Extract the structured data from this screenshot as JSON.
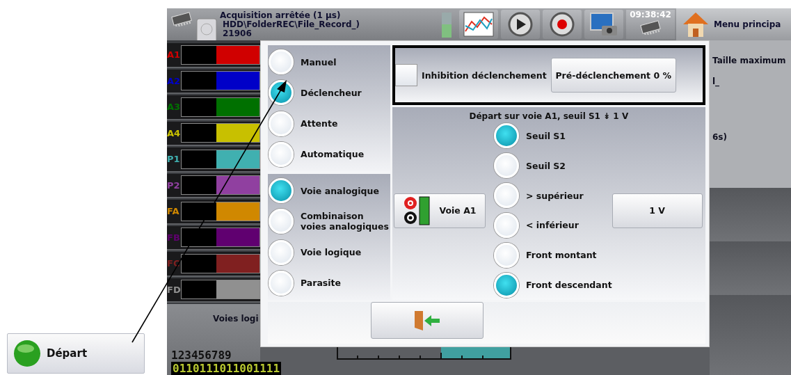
{
  "status": {
    "title": "Acquisition arrêtée (1 µs)",
    "path": "HDD\\FolderREC\\File_Record_)",
    "remaining": "21906"
  },
  "clock": "09:38:42",
  "main_menu": "Menu principa",
  "channels": [
    {
      "label": "A1",
      "color": "#d00000"
    },
    {
      "label": "A2",
      "color": "#0000c8"
    },
    {
      "label": "A3",
      "color": "#007000"
    },
    {
      "label": "A4",
      "color": "#c8c000"
    },
    {
      "label": "P1",
      "color": "#40b0b0"
    },
    {
      "label": "P2",
      "color": "#9040a0"
    },
    {
      "label": "FA",
      "color": "#d08800"
    },
    {
      "label": "FB",
      "color": "#600070"
    },
    {
      "label": "FC",
      "color": "#802020"
    },
    {
      "label": "FD",
      "color": "#909090"
    }
  ],
  "logic": {
    "title": "Voies logi",
    "numbers": "123456789",
    "bits": "0110111011001111"
  },
  "info": [
    "Taille maximum",
    "l_",
    "6s)"
  ],
  "start_button": "Départ",
  "dialog": {
    "modes": [
      {
        "label": "Manuel",
        "selected": false
      },
      {
        "label": "Déclencheur",
        "selected": true
      },
      {
        "label": "Attente",
        "selected": false
      },
      {
        "label": "Automatique",
        "selected": false
      }
    ],
    "sources": [
      {
        "label": "Voie analogique",
        "selected": true
      },
      {
        "label": "Combinaison voies analogiques",
        "selected": false
      },
      {
        "label": "Voie logique",
        "selected": false
      },
      {
        "label": "Parasite",
        "selected": false
      }
    ],
    "inhibit": {
      "label": "Inhibition déclenchement",
      "checked": false
    },
    "pretrigger": "Pré-déclenchement 0 %",
    "summary": "Départ sur voie A1, seuil S1 ↡ 1 V",
    "channel_button": "Voie A1",
    "level_button": "1 V",
    "conditions": [
      {
        "label": "Seuil S1",
        "selected": true
      },
      {
        "label": "Seuil S2",
        "selected": false
      },
      {
        "label": "> supérieur",
        "selected": false
      },
      {
        "label": "< inférieur",
        "selected": false
      },
      {
        "label": "Front montant",
        "selected": false
      },
      {
        "label": "Front descendant",
        "selected": true
      }
    ]
  }
}
